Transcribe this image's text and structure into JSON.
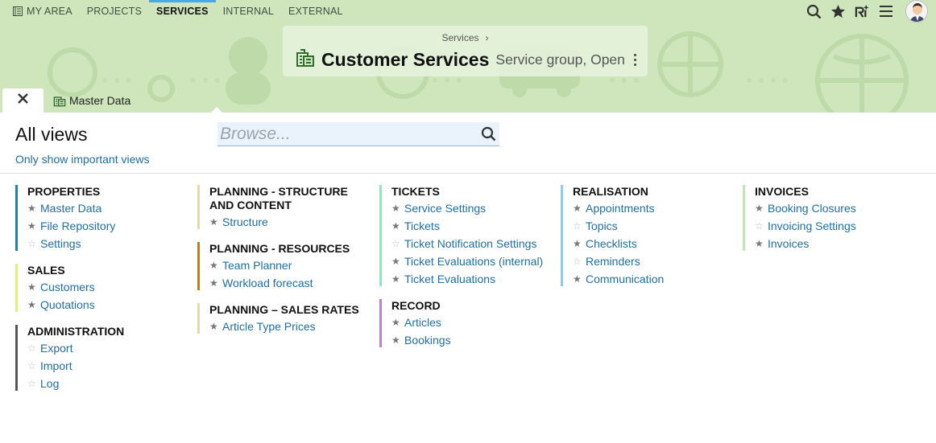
{
  "nav": {
    "items": [
      {
        "label": "MY AREA",
        "active": false
      },
      {
        "label": "PROJECTS",
        "active": false
      },
      {
        "label": "SERVICES",
        "active": true
      },
      {
        "label": "INTERNAL",
        "active": false
      },
      {
        "label": "EXTERNAL",
        "active": false
      }
    ],
    "tools": [
      "search-icon",
      "star-icon",
      "ai-icon",
      "menu-icon",
      "avatar"
    ]
  },
  "header": {
    "breadcrumb": "Services",
    "breadcrumb_sep": "›",
    "title": "Customer Services",
    "subtitle": "Service group, Open",
    "accent_color": "#4aa8e8",
    "band_color": "#cfe6bd"
  },
  "tabs": {
    "close_icon": "close-icon",
    "items": [
      {
        "label": "Master Data",
        "icon": "building-icon"
      }
    ]
  },
  "panel": {
    "heading": "All views",
    "important_link": "Only show important views",
    "browse_placeholder": "Browse...",
    "columns": [
      [
        {
          "title": "PROPERTIES",
          "color": "#1e7fb0",
          "items": [
            {
              "label": "Master Data",
              "starred": true
            },
            {
              "label": "File Repository",
              "starred": true
            },
            {
              "label": "Settings",
              "starred": false
            }
          ]
        },
        {
          "title": "SALES",
          "color": "#e6ee7a",
          "items": [
            {
              "label": "Customers",
              "starred": true
            },
            {
              "label": "Quotations",
              "starred": true
            }
          ]
        },
        {
          "title": "ADMINISTRATION",
          "color": "#555555",
          "items": [
            {
              "label": "Export",
              "starred": false
            },
            {
              "label": "Import",
              "starred": false
            },
            {
              "label": "Log",
              "starred": false
            }
          ]
        }
      ],
      [
        {
          "title": "PLANNING - STRUCTURE AND CONTENT",
          "color": "#ead9a6",
          "items": [
            {
              "label": "Structure",
              "starred": true
            }
          ]
        },
        {
          "title": "PLANNING - RESOURCES",
          "color": "#c87a15",
          "items": [
            {
              "label": "Team Planner",
              "starred": true
            },
            {
              "label": "Workload forecast",
              "starred": true
            }
          ]
        },
        {
          "title": "PLANNING – SALES RATES",
          "color": "#ead9a6",
          "items": [
            {
              "label": "Article Type Prices",
              "starred": true
            }
          ]
        }
      ],
      [
        {
          "title": "TICKETS",
          "color": "#8fe8c2",
          "items": [
            {
              "label": "Service Settings",
              "starred": true
            },
            {
              "label": "Tickets",
              "starred": true
            },
            {
              "label": "Ticket Notification Settings",
              "starred": false
            },
            {
              "label": "Ticket Evaluations (internal)",
              "starred": true
            },
            {
              "label": "Ticket Evaluations",
              "starred": true
            }
          ]
        },
        {
          "title": "RECORD",
          "color": "#c27fd6",
          "items": [
            {
              "label": "Articles",
              "starred": true
            },
            {
              "label": "Bookings",
              "starred": true
            }
          ]
        }
      ],
      [
        {
          "title": "REALISATION",
          "color": "#8ec9f0",
          "items": [
            {
              "label": "Appointments",
              "starred": true
            },
            {
              "label": "Topics",
              "starred": false
            },
            {
              "label": "Checklists",
              "starred": true
            },
            {
              "label": "Reminders",
              "starred": false
            },
            {
              "label": "Communication",
              "starred": true
            }
          ]
        }
      ],
      [
        {
          "title": "INVOICES",
          "color": "#bfe6b6",
          "items": [
            {
              "label": "Booking Closures",
              "starred": true
            },
            {
              "label": "Invoicing Settings",
              "starred": false
            },
            {
              "label": "Invoices",
              "starred": true
            }
          ]
        }
      ]
    ]
  }
}
